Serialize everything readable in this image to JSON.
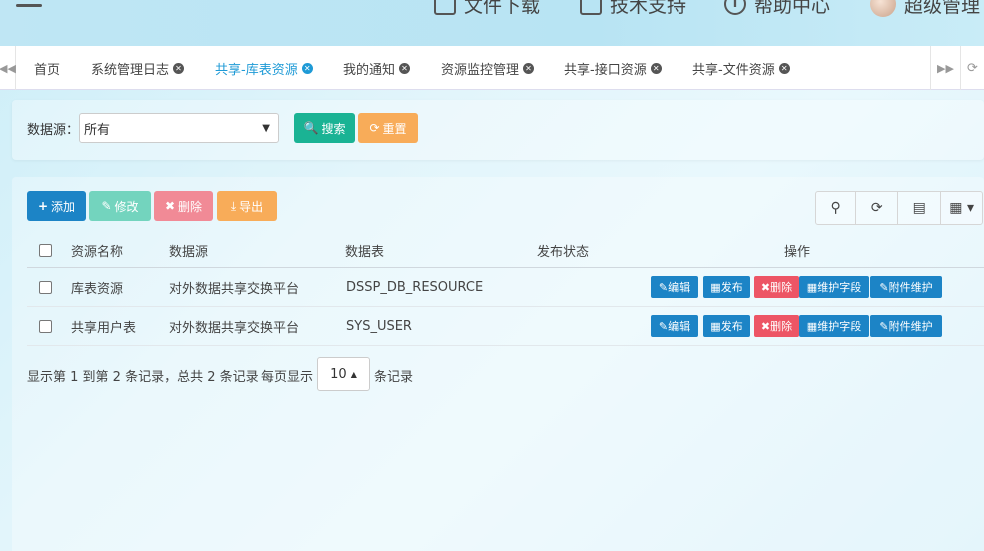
{
  "header": {
    "links": [
      {
        "label": "文件下载",
        "icon": "image-icon"
      },
      {
        "label": "技术支持",
        "icon": "bag-icon"
      },
      {
        "label": "帮助中心",
        "icon": "info-icon"
      }
    ],
    "user": "超级管理"
  },
  "tabs": [
    {
      "label": "首页",
      "closable": false
    },
    {
      "label": "系统管理日志",
      "closable": true
    },
    {
      "label": "共享-库表资源",
      "closable": true,
      "active": true
    },
    {
      "label": "我的通知",
      "closable": true
    },
    {
      "label": "资源监控管理",
      "closable": true
    },
    {
      "label": "共享-接口资源",
      "closable": true
    },
    {
      "label": "共享-文件资源",
      "closable": true
    }
  ],
  "search": {
    "label": "数据源：",
    "selected": "所有",
    "search_btn": "搜索",
    "reset_btn": "重置"
  },
  "toolbar": {
    "add": "添加",
    "edit": "修改",
    "delete": "删除",
    "export": "导出"
  },
  "table": {
    "columns": [
      "资源名称",
      "数据源",
      "数据表",
      "发布状态",
      "操作"
    ],
    "rows": [
      {
        "name": "库表资源",
        "source": "对外数据共享交换平台",
        "table": "DSSP_DB_RESOURCE",
        "status": ""
      },
      {
        "name": "共享用户表",
        "source": "对外数据共享交换平台",
        "table": "SYS_USER",
        "status": ""
      }
    ],
    "actions": {
      "edit": "编辑",
      "publish": "发布",
      "delete": "删除",
      "fields": "维护字段",
      "attachments": "附件维护"
    }
  },
  "pagination": {
    "summary": "显示第 1 到第 2 条记录，总共 2 条记录",
    "per_page_prefix": "每页显示",
    "per_page_value": "10",
    "per_page_suffix": "条记录"
  }
}
